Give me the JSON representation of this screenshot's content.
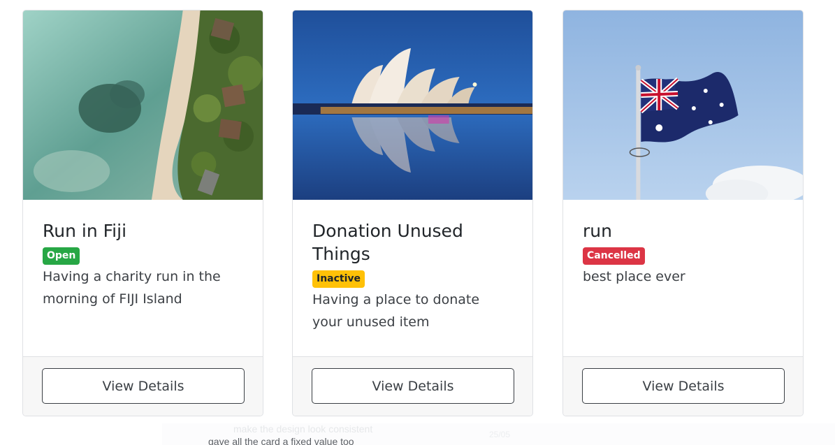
{
  "cards": [
    {
      "title": "Run in Fiji",
      "status": "Open",
      "status_color": "#27a745",
      "description": "Having a charity run in the morning of FIJI Island",
      "image": "aerial-island-beach-image",
      "button_label": "View Details"
    },
    {
      "title": "Donation Unused Things",
      "status": "Inactive",
      "status_color": "#ffc107",
      "description": "Having a place to donate your unused item",
      "image": "sydney-opera-house-image",
      "button_label": "View Details"
    },
    {
      "title": "run",
      "status": "Cancelled",
      "status_color": "#dc3545",
      "description": "best place ever",
      "image": "australian-flag-image",
      "button_label": "View Details"
    }
  ],
  "overlay_notes": {
    "line1": "make the design look consistent",
    "line2": "gave all the card a fixed value too",
    "faint": "25/05"
  }
}
